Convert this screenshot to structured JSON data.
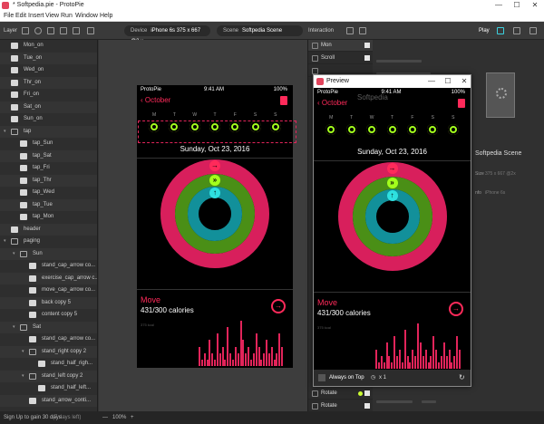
{
  "window": {
    "title": "* Softpedia.pie - ProtoPie",
    "minimize": "—",
    "maximize": "☐",
    "close": "✕"
  },
  "menu": [
    "File",
    "Edit",
    "Insert",
    "View",
    "Run",
    "Window",
    "Help"
  ],
  "toolbar": {
    "layer_label": "Layer",
    "device_label": "Device",
    "device_value": "iPhone 6s  375 x 667  @2 x",
    "scene_label": "Scene",
    "scene_value": "Softpedia Scene",
    "interaction_label": "Interaction",
    "play_label": "Play"
  },
  "layers": [
    {
      "label": "Mon_on",
      "indent": 0,
      "type": "image"
    },
    {
      "label": "Tue_on",
      "indent": 0,
      "type": "image"
    },
    {
      "label": "Wed_on",
      "indent": 0,
      "type": "image"
    },
    {
      "label": "Thr_on",
      "indent": 0,
      "type": "image"
    },
    {
      "label": "Fri_on",
      "indent": 0,
      "type": "image"
    },
    {
      "label": "Sat_on",
      "indent": 0,
      "type": "image"
    },
    {
      "label": "Sun_on",
      "indent": 0,
      "type": "image"
    },
    {
      "label": "tap",
      "indent": 0,
      "type": "folder"
    },
    {
      "label": "tap_Sun",
      "indent": 1,
      "type": "image"
    },
    {
      "label": "tap_Sat",
      "indent": 1,
      "type": "image"
    },
    {
      "label": "tap_Fri",
      "indent": 1,
      "type": "image"
    },
    {
      "label": "tap_Thr",
      "indent": 1,
      "type": "image"
    },
    {
      "label": "tap_Wed",
      "indent": 1,
      "type": "image"
    },
    {
      "label": "tap_Tue",
      "indent": 1,
      "type": "image"
    },
    {
      "label": "tap_Mon",
      "indent": 1,
      "type": "image"
    },
    {
      "label": "header",
      "indent": 0,
      "type": "image"
    },
    {
      "label": "paging",
      "indent": 0,
      "type": "folder"
    },
    {
      "label": "Sun",
      "indent": 1,
      "type": "folder"
    },
    {
      "label": "stand_cap_arrow co...",
      "indent": 2,
      "type": "image"
    },
    {
      "label": "exercise_cap_arrow c...",
      "indent": 2,
      "type": "image"
    },
    {
      "label": "move_cap_arrow co...",
      "indent": 2,
      "type": "image"
    },
    {
      "label": "back copy 5",
      "indent": 2,
      "type": "image"
    },
    {
      "label": "content copy 5",
      "indent": 2,
      "type": "image"
    },
    {
      "label": "Sat",
      "indent": 1,
      "type": "folder"
    },
    {
      "label": "stand_cap_arrow co...",
      "indent": 2,
      "type": "image"
    },
    {
      "label": "stand_right copy 2",
      "indent": 2,
      "type": "folder"
    },
    {
      "label": "stand_half_righ...",
      "indent": 3,
      "type": "image"
    },
    {
      "label": "stand_left copy 2",
      "indent": 2,
      "type": "folder"
    },
    {
      "label": "stand_half_left...",
      "indent": 3,
      "type": "image"
    },
    {
      "label": "stand_arrow_conti...",
      "indent": 2,
      "type": "image"
    }
  ],
  "status": {
    "signup": "Sign Up to gain 30 days",
    "days_left": "(7 days left)",
    "zoom": "100%",
    "zoom_out": "—",
    "zoom_in": "+"
  },
  "phone": {
    "carrier": "ProtoPie",
    "time": "9:41 AM",
    "battery": "100%",
    "back_label": "October",
    "days": [
      "M",
      "T",
      "W",
      "T",
      "F",
      "S",
      "S"
    ],
    "date": "Sunday, Oct 23, 2016",
    "move_title": "Move",
    "calories": "431/300 calories",
    "ytick": "375 kcal"
  },
  "interaction": {
    "items": [
      {
        "label": "Mon",
        "type": "trigger"
      },
      {
        "label": "Scroll",
        "type": "response"
      },
      {
        "label": "",
        "type": "blank"
      },
      {
        "label": "Rotate",
        "type": "response"
      },
      {
        "label": "Rotate",
        "type": "response"
      },
      {
        "label": "Rotate",
        "type": "response"
      }
    ]
  },
  "props": {
    "scene_name": "Softpedia Scene",
    "size_label": "Size",
    "size_value": "375 x 667 @2x",
    "info_label": "nfo",
    "info_value": "iPhone 6s"
  },
  "preview": {
    "title": "Preview",
    "always_on_top": "Always on Top",
    "speed": "x 1",
    "watermark": "Softpedia"
  },
  "colors": {
    "move": "#ff2a5a",
    "move_ring": "#d81f5c",
    "exercise": "#a3ff1c",
    "stand": "#2ee0e0"
  },
  "chart_data": {
    "type": "bar",
    "title": "",
    "values": [
      3,
      1,
      2,
      1,
      4,
      2,
      1,
      5,
      2,
      3,
      1,
      6,
      2,
      1,
      3,
      2,
      7,
      4,
      2,
      3,
      1,
      2,
      5,
      3,
      1,
      2,
      4,
      2,
      3,
      1,
      2,
      5,
      3
    ]
  }
}
